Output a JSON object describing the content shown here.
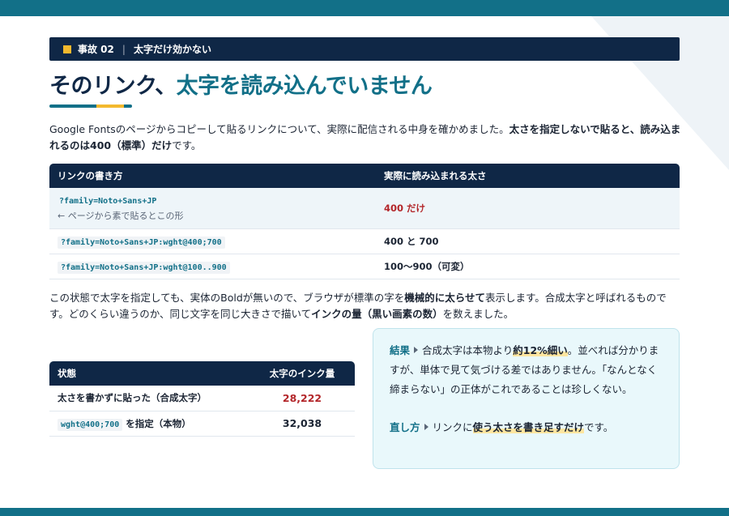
{
  "header": {
    "label": "事故 02",
    "separator": "|",
    "subtitle": "太字だけ効かない"
  },
  "title": {
    "prefix": "そのリンク、",
    "accent": "太字を読み込んでいません"
  },
  "intro": {
    "text": "Google Fontsのページからコピーして貼るリンクについて、実際に配信される中身を確かめました。",
    "bold": "太さを指定しないで貼ると、読み込まれるのは400（標準）だけ",
    "tail": "です。"
  },
  "link_table": {
    "headers": [
      "リンクの書き方",
      "実際に読み込まれる太さ"
    ],
    "rows": [
      {
        "code": "?family=Noto+Sans+JP",
        "note": "← ページから素で貼るとこの形",
        "result": "400 だけ"
      },
      {
        "code": "?family=Noto+Sans+JP:wght@400;700",
        "note": "",
        "result": "400 と 700"
      },
      {
        "code": "?family=Noto+Sans+JP:wght@100..900",
        "note": "",
        "result": "100〜900（可変）"
      }
    ]
  },
  "para2": {
    "part1": "この状態で太字を指定しても、実体のBoldが無いので、ブラウザが標準の字を",
    "bold1": "機械的に太らせて",
    "part2": "表示します。合成太字と呼ばれるものです。どのくらい違うのか、同じ文字を同じ大きさで描いて",
    "bold2": "インクの量（黒い画素の数）",
    "part3": "を数えました。"
  },
  "ink_table": {
    "headers": [
      "状態",
      "太字のインク量"
    ],
    "rows": [
      {
        "label": "太さを書かずに貼った（合成太字）",
        "code": "",
        "suffix": "",
        "value": "28,222"
      },
      {
        "label": "",
        "code": "wght@400;700",
        "suffix": "を指定（本物）",
        "value": "32,038"
      }
    ]
  },
  "result": {
    "lead": "結果",
    "text1": "合成太字は本物より",
    "highlight": "約12%細い",
    "text2": "。並べれば分かりますが、単体で見て気づける差ではありません。「なんとなく締まらない」の正体がこれであることは珍しくない。",
    "fix_lead": "直し方",
    "fix_text1": "リンクに",
    "fix_highlight": "使う太さを書き足すだけ",
    "fix_text2": "です。"
  },
  "colors": {
    "navy": "#0f2746",
    "teal": "#127088",
    "gold": "#f3b92e",
    "red": "#b3262a",
    "result_bg": "#e9f8fb"
  }
}
